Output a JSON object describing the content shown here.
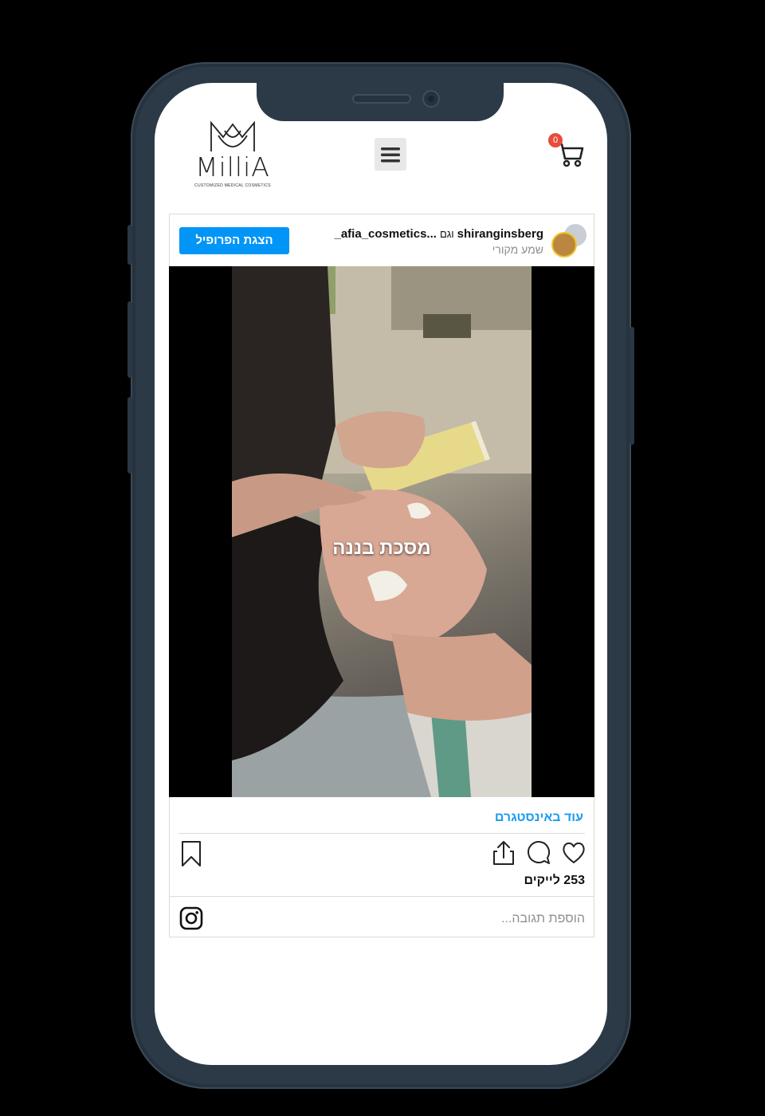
{
  "header": {
    "logo_text": "MilliA",
    "logo_tagline": "CUSTOMIZED MEDICAL COSMETICS",
    "cart_count": "0",
    "menu_icon": "hamburger-icon",
    "cart_icon": "cart-icon"
  },
  "post": {
    "author": "shiranginsberg",
    "connector": "וגם",
    "coauthor": "...afia_cosmetics_",
    "audio": "שמע מקורי",
    "profile_button": "הצגת הפרופיל",
    "video_caption": "מסכת בננה",
    "more_link": "עוד באינסטגרם",
    "likes": "253 לייקים",
    "comment_placeholder": "הוספת תגובה..."
  },
  "colors": {
    "accent": "#0095f6",
    "link": "#1d9bf0",
    "badge": "#e74c3c",
    "frame": "#2c3a47"
  }
}
